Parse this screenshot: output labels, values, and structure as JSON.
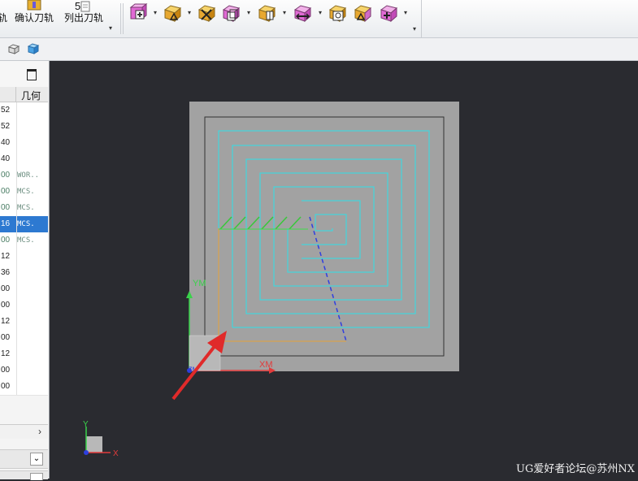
{
  "toolbar": {
    "confirm_toolpath": "确认刀轨",
    "list_toolpath": "列出刀轨",
    "cut_left_label": "轨",
    "list_num": "5"
  },
  "panel": {
    "column_geometry": "几何",
    "rows": [
      {
        "num": "52",
        "geom": ""
      },
      {
        "num": "52",
        "geom": ""
      },
      {
        "num": "40",
        "geom": ""
      },
      {
        "num": "40",
        "geom": ""
      },
      {
        "num": "00",
        "geom": "WOR.."
      },
      {
        "num": "00",
        "geom": "MCS."
      },
      {
        "num": "00",
        "geom": "MCS."
      },
      {
        "num": "16",
        "geom": "MCS."
      },
      {
        "num": "00",
        "geom": "MCS."
      },
      {
        "num": "12",
        "geom": ""
      },
      {
        "num": "36",
        "geom": ""
      },
      {
        "num": "00",
        "geom": ""
      },
      {
        "num": "00",
        "geom": ""
      },
      {
        "num": "12",
        "geom": ""
      },
      {
        "num": "00",
        "geom": ""
      },
      {
        "num": "12",
        "geom": ""
      },
      {
        "num": "00",
        "geom": ""
      },
      {
        "num": "00",
        "geom": ""
      }
    ],
    "selected_row": 7
  },
  "viewport": {
    "label_ym": "YM",
    "label_xm": "XM",
    "label_zm": "ZM",
    "label_y": "Y",
    "label_x": "X",
    "watermark": "UG爱好者论坛@苏州NX"
  }
}
